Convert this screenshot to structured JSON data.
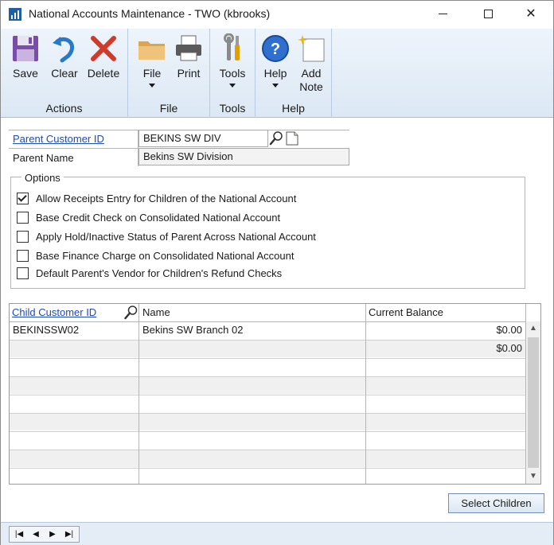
{
  "window": {
    "title": "National Accounts Maintenance  -  TWO (kbrooks)",
    "min_glyph": "",
    "max_glyph": "",
    "close_glyph": "✕"
  },
  "ribbon": {
    "groups": [
      {
        "label": "Actions",
        "buttons": [
          {
            "label": "Save",
            "icon": "save-icon"
          },
          {
            "label": "Clear",
            "icon": "clear-icon"
          },
          {
            "label": "Delete",
            "icon": "delete-icon"
          }
        ]
      },
      {
        "label": "File",
        "buttons": [
          {
            "label": "File",
            "icon": "folder-icon"
          },
          {
            "label": "Print",
            "icon": "printer-icon"
          }
        ]
      },
      {
        "label": "Tools",
        "buttons": [
          {
            "label": "Tools",
            "icon": "tools-icon"
          }
        ]
      },
      {
        "label": "Help",
        "buttons": [
          {
            "label": "Help",
            "icon": "help-icon"
          },
          {
            "label": "Add",
            "label2": "Note",
            "icon": "add-note-icon"
          }
        ]
      }
    ]
  },
  "form": {
    "parent_customer_id_label": "Parent Customer ID",
    "parent_customer_id_value": "BEKINS SW DIV",
    "parent_name_label": "Parent Name",
    "parent_name_value": "Bekins SW Division"
  },
  "options": {
    "legend": "Options",
    "items": [
      {
        "label": "Allow Receipts Entry for Children of the National Account",
        "checked": true
      },
      {
        "label": "Base Credit Check on Consolidated National Account",
        "checked": false
      },
      {
        "label": "Apply Hold/Inactive Status of Parent Across National Account",
        "checked": false
      },
      {
        "label": "Base Finance Charge on Consolidated National Account",
        "checked": false
      },
      {
        "label": "Default Parent's Vendor for Children's Refund Checks",
        "checked": false
      }
    ]
  },
  "grid": {
    "columns": [
      "Child Customer ID",
      "Name",
      "Current Balance"
    ],
    "rows": [
      {
        "id": "BEKINSSW02",
        "name": "Bekins SW Branch 02",
        "balance": "$0.00"
      },
      {
        "id": "",
        "name": "",
        "balance": "$0.00"
      }
    ]
  },
  "select_children_label": "Select Children",
  "colors": {
    "ribbon_bg": "#dce8f5",
    "link": "#1d4bb8",
    "status_bar": "#e4ecf6"
  }
}
